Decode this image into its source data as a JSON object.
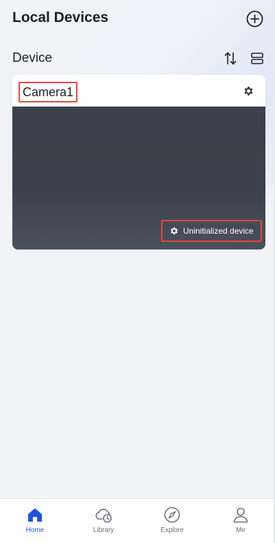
{
  "header": {
    "title": "Local Devices",
    "add_icon": "plus-circle-icon"
  },
  "section": {
    "title": "Device",
    "sort_icon": "sort-arrows-icon",
    "layout_icon": "list-layout-icon"
  },
  "devices": [
    {
      "name": "Camera1",
      "settings_icon": "gear-icon",
      "status": "Uninitialized device",
      "status_icon": "gear-icon"
    }
  ],
  "tabbar": {
    "tabs": [
      {
        "label": "Home",
        "icon": "home-icon",
        "active": true
      },
      {
        "label": "Library",
        "icon": "cloud-clock-icon",
        "active": false
      },
      {
        "label": "Explore",
        "icon": "compass-icon",
        "active": false
      },
      {
        "label": "Me",
        "icon": "person-icon",
        "active": false
      }
    ]
  },
  "colors": {
    "accent": "#1f55d6",
    "highlight_border": "#e04a3a",
    "preview_bg": "#3c424d",
    "page_bg": "#f2f3f6"
  }
}
